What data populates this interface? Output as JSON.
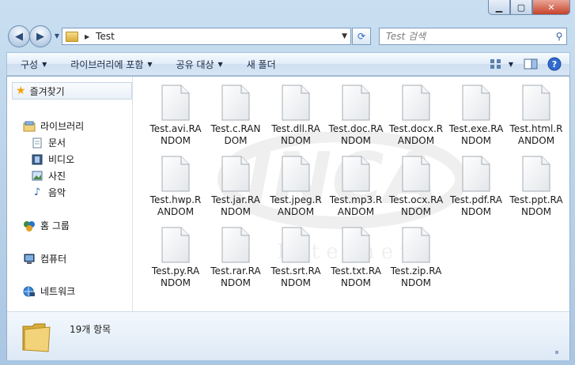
{
  "address": {
    "crumb": "Test"
  },
  "search": {
    "placeholder": "Test 검색"
  },
  "toolbar": {
    "organize": "구성",
    "include_in_library": "라이브러리에 포함",
    "share_with": "공유 대상",
    "new_folder": "새 폴더"
  },
  "sidebar": {
    "favorites": "즐겨찾기",
    "libraries": "라이브러리",
    "documents": "문서",
    "videos": "비디오",
    "pictures": "사진",
    "music": "음악",
    "homegroup": "홈 그룹",
    "computer": "컴퓨터",
    "network": "네트워크"
  },
  "watermark": {
    "brand": "INCA",
    "tagline": "I n t e r n e t"
  },
  "files": [
    {
      "line1": "Test.avi.RA",
      "line2": "NDOM"
    },
    {
      "line1": "Test.c.RAN",
      "line2": "DOM"
    },
    {
      "line1": "Test.dll.RA",
      "line2": "NDOM"
    },
    {
      "line1": "Test.doc.RA",
      "line2": "NDOM"
    },
    {
      "line1": "Test.docx.R",
      "line2": "ANDOM"
    },
    {
      "line1": "Test.exe.RA",
      "line2": "NDOM"
    },
    {
      "line1": "Test.html.R",
      "line2": "ANDOM"
    },
    {
      "line1": "Test.hwp.R",
      "line2": "ANDOM"
    },
    {
      "line1": "Test.jar.RA",
      "line2": "NDOM"
    },
    {
      "line1": "Test.jpeg.R",
      "line2": "ANDOM"
    },
    {
      "line1": "Test.mp3.R",
      "line2": "ANDOM"
    },
    {
      "line1": "Test.ocx.RA",
      "line2": "NDOM"
    },
    {
      "line1": "Test.pdf.RA",
      "line2": "NDOM"
    },
    {
      "line1": "Test.ppt.RA",
      "line2": "NDOM"
    },
    {
      "line1": "Test.py.RA",
      "line2": "NDOM"
    },
    {
      "line1": "Test.rar.RA",
      "line2": "NDOM"
    },
    {
      "line1": "Test.srt.RA",
      "line2": "NDOM"
    },
    {
      "line1": "Test.txt.RA",
      "line2": "NDOM"
    },
    {
      "line1": "Test.zip.RA",
      "line2": "NDOM"
    }
  ],
  "details": {
    "count": "19개 항목"
  },
  "icons": {
    "favorites": "star-icon",
    "library": "library-icon",
    "homegroup": "homegroup-icon",
    "computer": "computer-icon",
    "network": "network-icon",
    "file": "blank-file-icon"
  }
}
